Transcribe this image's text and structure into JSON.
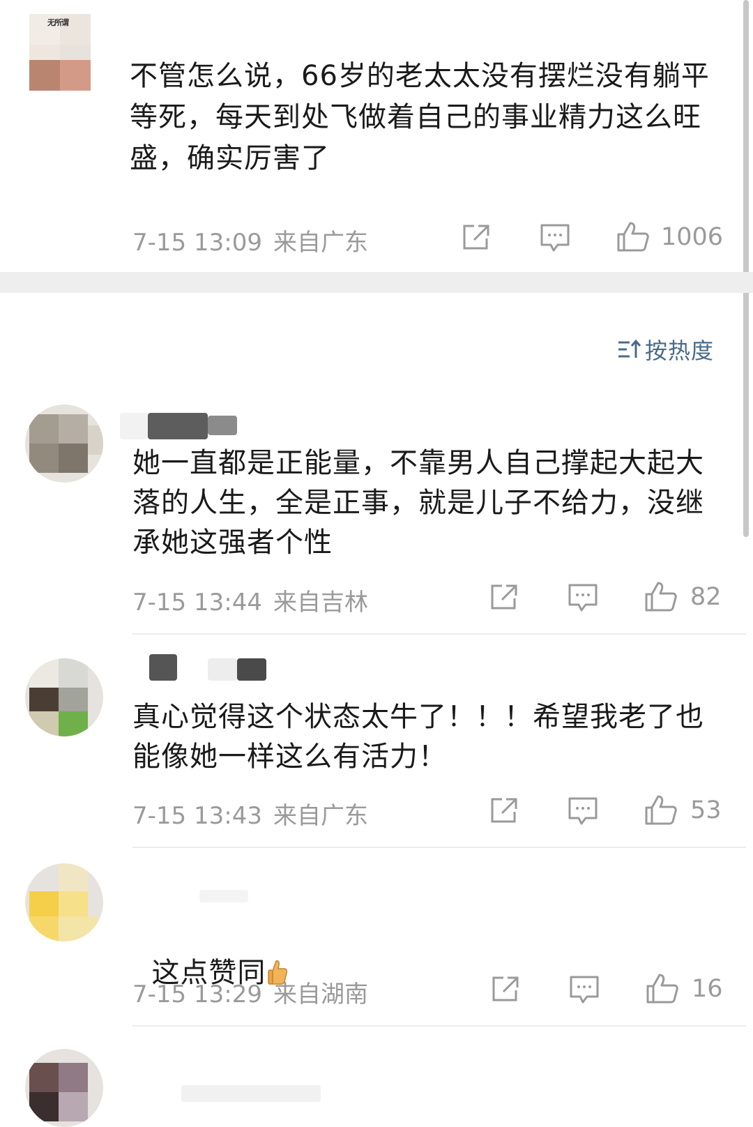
{
  "main_comment": {
    "avatar_text": "无所谓",
    "text": "不管怎么说，66岁的老太太没有摆烂没有躺平等死，每天到处飞做着自己的事业精力这么旺盛，确实厉害了",
    "time": "7-15 13:09",
    "location": "来自广东",
    "likes": "1006"
  },
  "sort": {
    "label": "按热度"
  },
  "replies": [
    {
      "text": "她一直都是正能量，不靠男人自己撑起大起大落的人生，全是正事，就是儿子不给力，没继承她这强者个性",
      "time": "7-15 13:44",
      "location": "来自吉林",
      "likes": "82"
    },
    {
      "text": "真心觉得这个状态太牛了！！！希望我老了也能像她一样这么有活力！",
      "time": "7-15 13:43",
      "location": "来自广东",
      "likes": "53"
    },
    {
      "text": "这点赞同",
      "time": "7-15 13:29",
      "location": "来自湖南",
      "likes": "16"
    }
  ],
  "icons": {
    "share": "share-icon",
    "comment": "comment-icon",
    "like": "thumbs-up-icon",
    "sort": "sort-icon",
    "emoji": "thumbs-up-emoji-icon"
  },
  "colors": {
    "meta_text": "#9a9a9a",
    "sort_text": "#4a6a8a",
    "divider_band": "#eeeeee"
  }
}
